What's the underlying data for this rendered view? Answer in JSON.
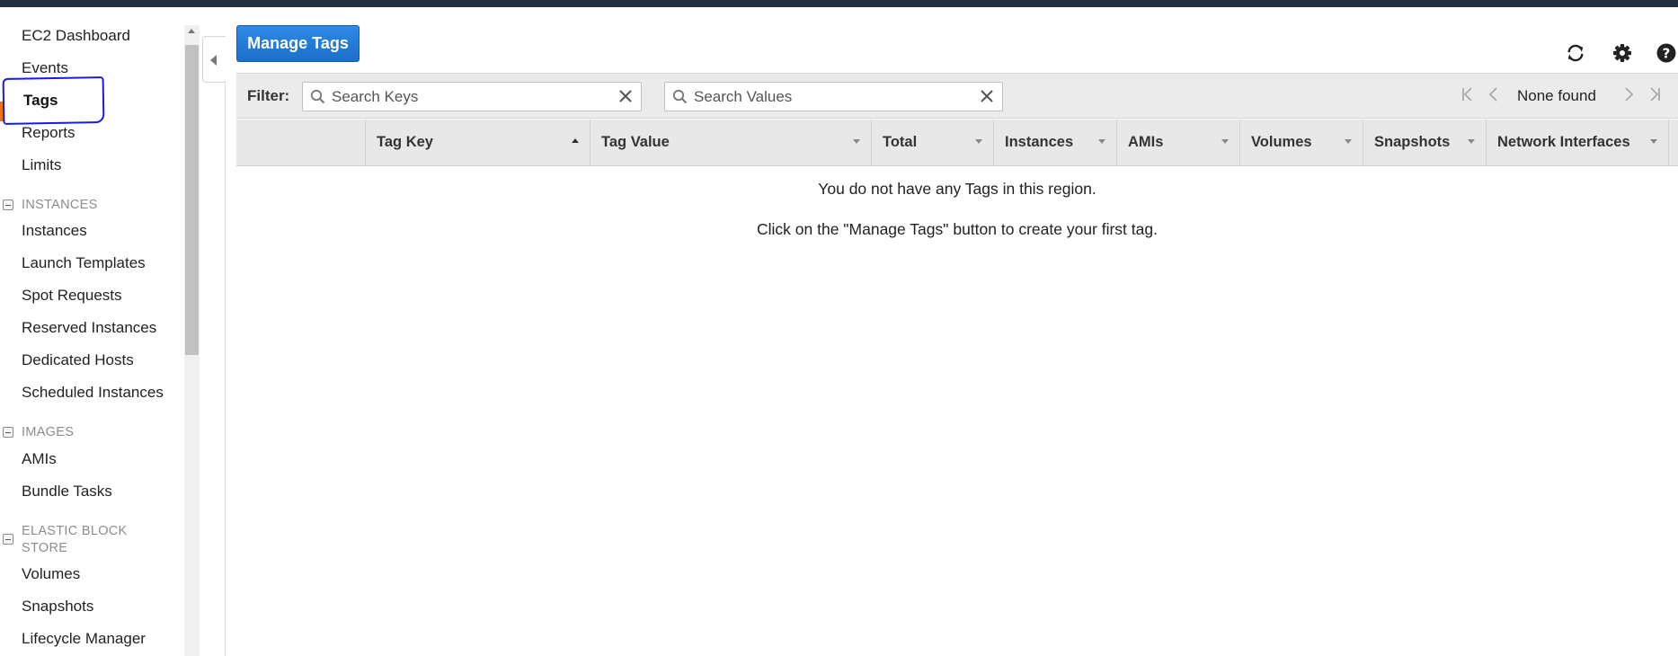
{
  "sidebar": {
    "items": [
      {
        "label": "EC2 Dashboard"
      },
      {
        "label": "Events"
      },
      {
        "label": "Tags"
      },
      {
        "label": "Reports"
      },
      {
        "label": "Limits"
      }
    ],
    "sections": [
      {
        "title": "INSTANCES",
        "items": [
          "Instances",
          "Launch Templates",
          "Spot Requests",
          "Reserved Instances",
          "Dedicated Hosts",
          "Scheduled Instances"
        ]
      },
      {
        "title": "IMAGES",
        "items": [
          "AMIs",
          "Bundle Tasks"
        ]
      },
      {
        "title": "ELASTIC BLOCK STORE",
        "items": [
          "Volumes",
          "Snapshots",
          "Lifecycle Manager"
        ]
      }
    ],
    "active_item": "Tags"
  },
  "toolbar": {
    "manage_tags_label": "Manage Tags",
    "icons": [
      "refresh-icon",
      "gear-icon",
      "help-icon"
    ]
  },
  "filter": {
    "label": "Filter:",
    "keys_placeholder": "Search Keys",
    "values_placeholder": "Search Values",
    "pager_text": "None found"
  },
  "table": {
    "columns": [
      {
        "label": ""
      },
      {
        "label": "Tag Key",
        "sort": "asc"
      },
      {
        "label": "Tag Value"
      },
      {
        "label": "Total"
      },
      {
        "label": "Instances"
      },
      {
        "label": "AMIs"
      },
      {
        "label": "Volumes"
      },
      {
        "label": "Snapshots"
      },
      {
        "label": "Network Interfaces"
      }
    ],
    "empty_line1": "You do not have any Tags in this region.",
    "empty_line2": "Click on the \"Manage Tags\" button to create your first tag."
  },
  "colors": {
    "primary_button": "#1a6fc9",
    "topbar": "#232f3e",
    "active_marker": "#ec7211",
    "annotation": "#1a1ae6"
  }
}
